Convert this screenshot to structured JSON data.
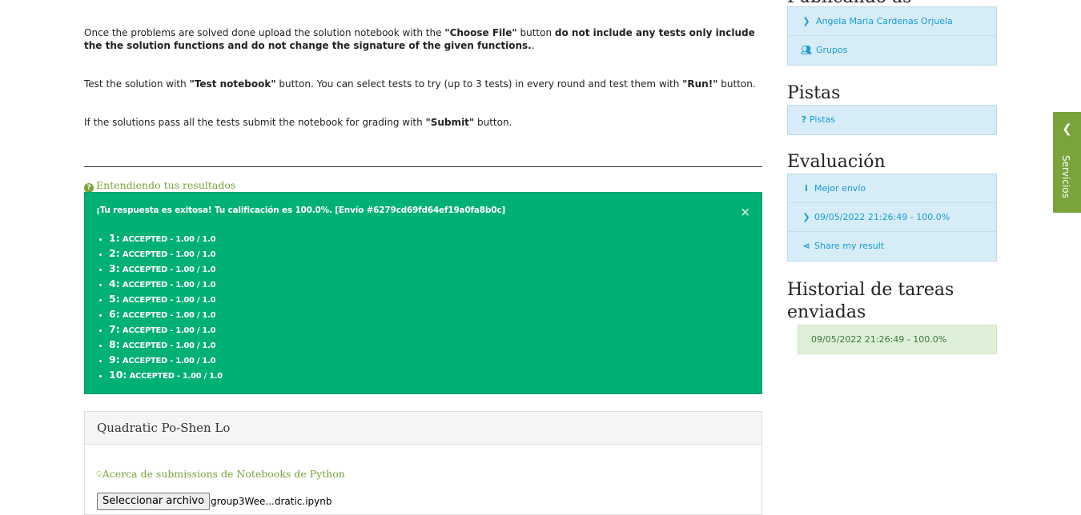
{
  "instructions": {
    "p1_a": "Once the problems are solved done upload the solution notebook with the ",
    "p1_b": "\"Choose File\"",
    "p1_c": " button ",
    "p1_d": "do not include any tests only include the the solution functions and do not change the signature of the given functions.",
    "p1_e": ".",
    "p2_a": "Test the solution with ",
    "p2_b": "\"Test notebook\"",
    "p2_c": " button. You can select tests to try (up to 3 tests) in every round and test them with ",
    "p2_d": "\"Run!\"",
    "p2_e": " button.",
    "p3_a": "If the solutions pass all the tests submit the notebook for grading with ",
    "p3_b": "\"Submit\"",
    "p3_c": " button."
  },
  "understanding_link": "Entendiendo tus resultados",
  "result_alert": {
    "header": "¡Tu respuesta es exitosa! Tu calificación es 100.0%. [Envío #6279cd69fd64ef19a0fa8b0c]",
    "close": "×",
    "tests": [
      {
        "num": "1:",
        "status": "ACCEPTED - 1.00 / 1.0"
      },
      {
        "num": "2:",
        "status": "ACCEPTED - 1.00 / 1.0"
      },
      {
        "num": "3:",
        "status": "ACCEPTED - 1.00 / 1.0"
      },
      {
        "num": "4:",
        "status": "ACCEPTED - 1.00 / 1.0"
      },
      {
        "num": "5:",
        "status": "ACCEPTED - 1.00 / 1.0"
      },
      {
        "num": "6:",
        "status": "ACCEPTED - 1.00 / 1.0"
      },
      {
        "num": "7:",
        "status": "ACCEPTED - 1.00 / 1.0"
      },
      {
        "num": "8:",
        "status": "ACCEPTED - 1.00 / 1.0"
      },
      {
        "num": "9:",
        "status": "ACCEPTED - 1.00 / 1.0"
      },
      {
        "num": "10:",
        "status": "ACCEPTED - 1.00 / 1.0"
      }
    ]
  },
  "panel": {
    "title": "Quadratic Po-Shen Lo",
    "about_link": "Acerca de submissions de Notebooks de Python",
    "file_button": "Seleccionar archivo",
    "file_name": "group3Wee...dratic.ipynb"
  },
  "sidebar": {
    "top_title_partial": "Publicando as",
    "user_items": [
      {
        "icon": "chevron-right-icon",
        "label": "Angela Maria Cardenas Orjuela"
      },
      {
        "icon": "users-icon",
        "label": "Grupos"
      }
    ],
    "hints_title": "Pistas",
    "hints_items": [
      {
        "icon": "question-icon",
        "label": "Pistas"
      }
    ],
    "eval_title": "Evaluación",
    "eval_items": [
      {
        "icon": "info-icon",
        "label": "Mejor envío"
      },
      {
        "icon": "chevron-right-icon",
        "label": "09/05/2022 21:26:49 - 100.0%"
      },
      {
        "icon": "share-icon",
        "label": "Share my result"
      }
    ],
    "history_title": "Historial de tareas enviadas",
    "history_items": [
      "09/05/2022 21:26:49 - 100.0%"
    ]
  },
  "services_tab": {
    "label": "Servicios",
    "icon": "chevron-left-icon"
  },
  "colors": {
    "success": "#00b074",
    "accent_green": "#7aa33b",
    "link_blue": "#1a9bd7",
    "info_bg": "#d6ecf7"
  }
}
